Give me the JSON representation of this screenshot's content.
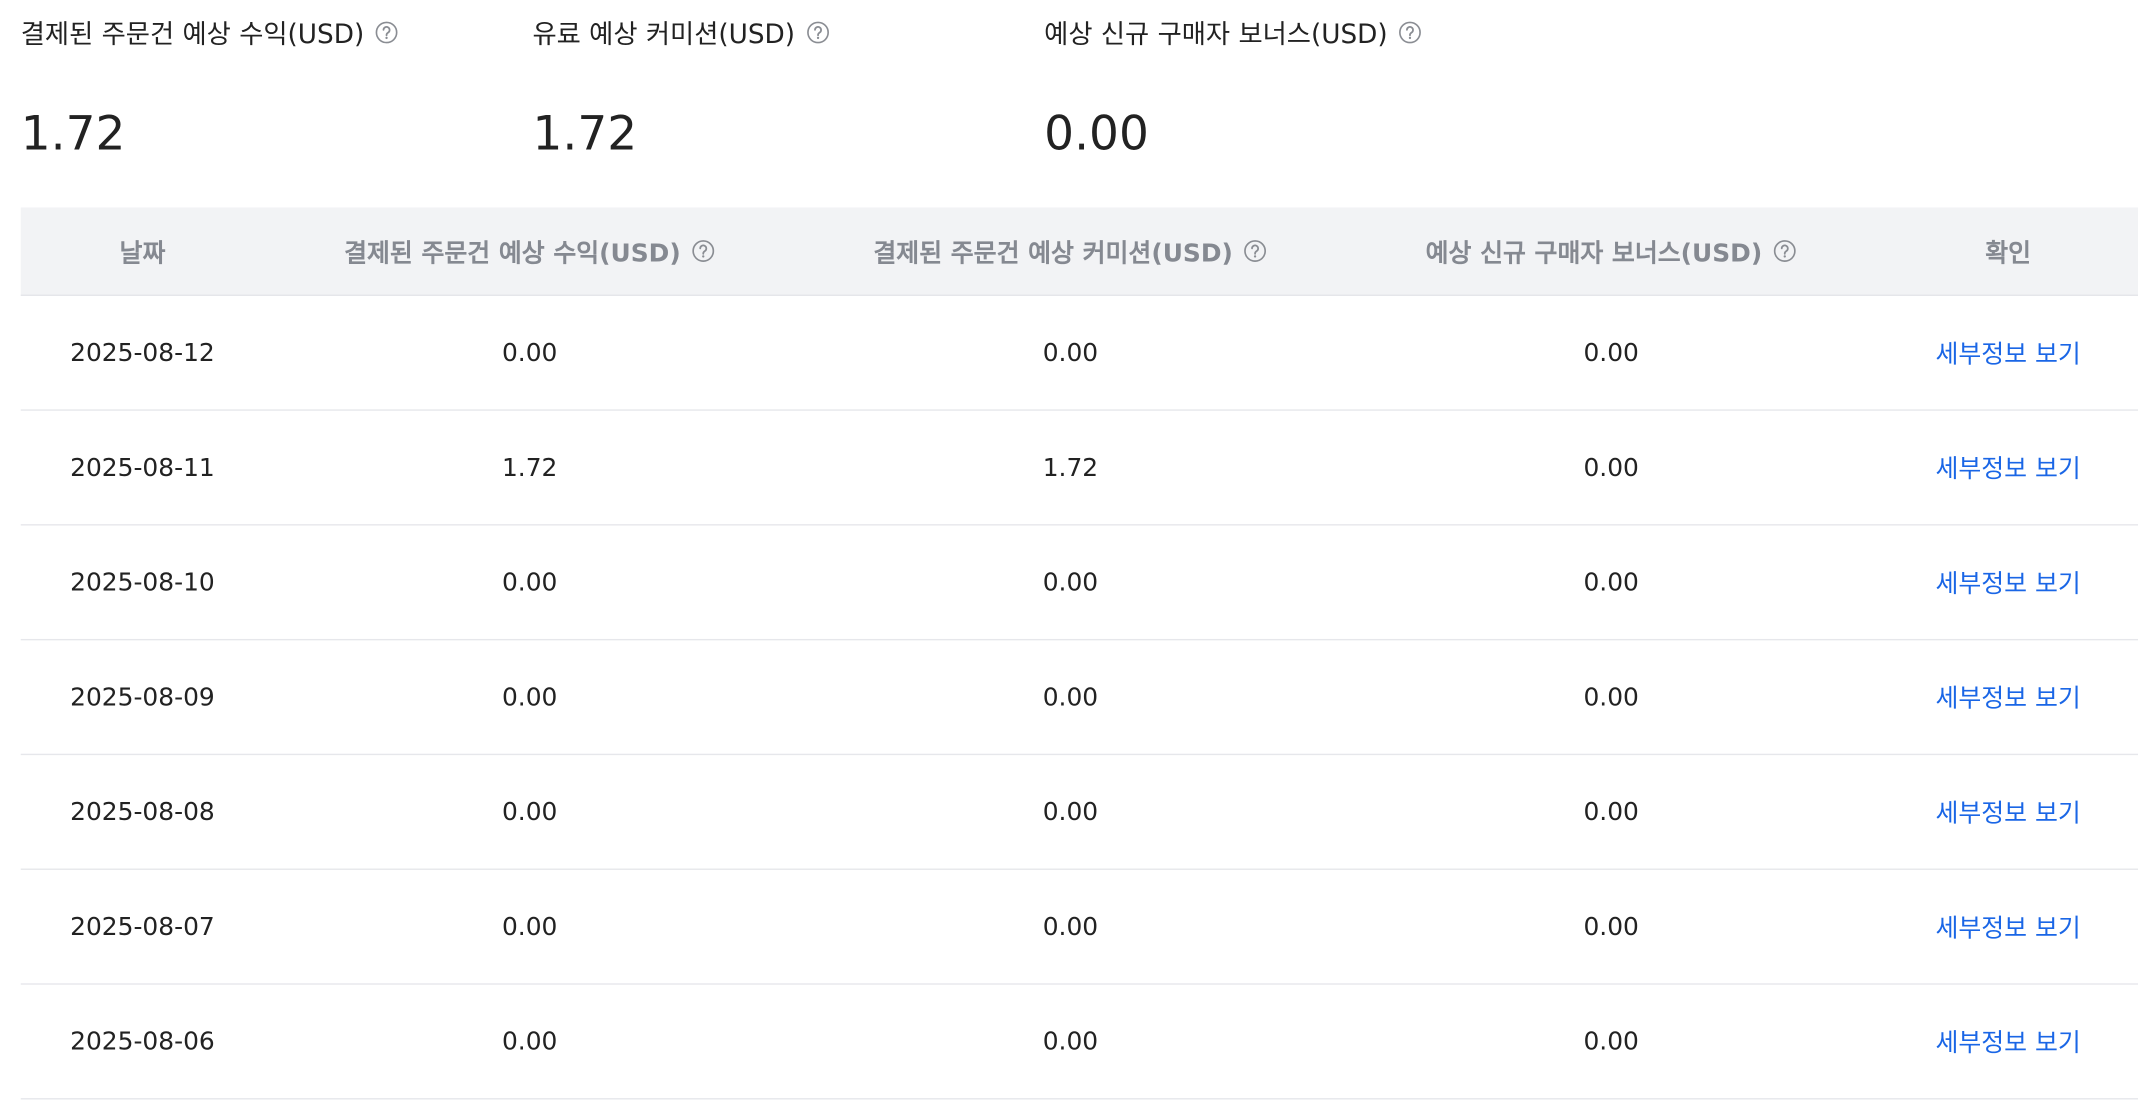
{
  "summary": {
    "paid_revenue": {
      "label": "결제된 주문건 예상 수익(USD)",
      "value": "1.72",
      "icon": "help-circle-icon"
    },
    "paid_commission": {
      "label": "유료 예상 커미션(USD)",
      "value": "1.72",
      "icon": "help-circle-icon"
    },
    "new_buyer_bonus": {
      "label": "예상 신규 구매자 보너스(USD)",
      "value": "0.00",
      "icon": "help-circle-icon"
    }
  },
  "table": {
    "headers": {
      "date": "날짜",
      "revenue": "결제된 주문건 예상 수익(USD)",
      "commission": "결제된 주문건 예상 커미션(USD)",
      "bonus": "예상 신규 구매자 보너스(USD)",
      "action": "확인"
    },
    "rows": [
      {
        "date": "2025-08-12",
        "revenue": "0.00",
        "commission": "0.00",
        "bonus": "0.00",
        "action": "세부정보 보기"
      },
      {
        "date": "2025-08-11",
        "revenue": "1.72",
        "commission": "1.72",
        "bonus": "0.00",
        "action": "세부정보 보기"
      },
      {
        "date": "2025-08-10",
        "revenue": "0.00",
        "commission": "0.00",
        "bonus": "0.00",
        "action": "세부정보 보기"
      },
      {
        "date": "2025-08-09",
        "revenue": "0.00",
        "commission": "0.00",
        "bonus": "0.00",
        "action": "세부정보 보기"
      },
      {
        "date": "2025-08-08",
        "revenue": "0.00",
        "commission": "0.00",
        "bonus": "0.00",
        "action": "세부정보 보기"
      },
      {
        "date": "2025-08-07",
        "revenue": "0.00",
        "commission": "0.00",
        "bonus": "0.00",
        "action": "세부정보 보기"
      },
      {
        "date": "2025-08-06",
        "revenue": "0.00",
        "commission": "0.00",
        "bonus": "0.00",
        "action": "세부정보 보기"
      }
    ]
  },
  "colors": {
    "link": "#1a66e6",
    "header_bg": "#f2f3f5",
    "header_text": "#858991",
    "text": "#222222"
  }
}
